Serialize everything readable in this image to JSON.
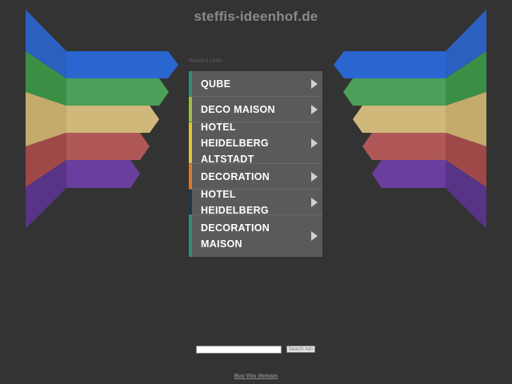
{
  "site_title": "steffis-ideenhof.de",
  "related_label": "Related Links",
  "links": [
    {
      "label": "QUBE",
      "color": "#2f8f7a"
    },
    {
      "label": "DECO MAISON",
      "color": "#9ec23a"
    },
    {
      "label": "HOTEL HEIDELBERG ALTSTADT",
      "color": "#e0c830"
    },
    {
      "label": "DECORATION",
      "color": "#e07820"
    },
    {
      "label": "HOTEL HEIDELBERG",
      "color": "#1a3a4a"
    },
    {
      "label": "DECORATION MAISON",
      "color": "#2f8f7a"
    }
  ],
  "search": {
    "button_label": "Search Ads",
    "value": ""
  },
  "buy_link": "Buy this domain",
  "stripe_colors": [
    "#2b5fc0",
    "#2f8f3f",
    "#c8b070",
    "#b05050",
    "#5a3590"
  ]
}
